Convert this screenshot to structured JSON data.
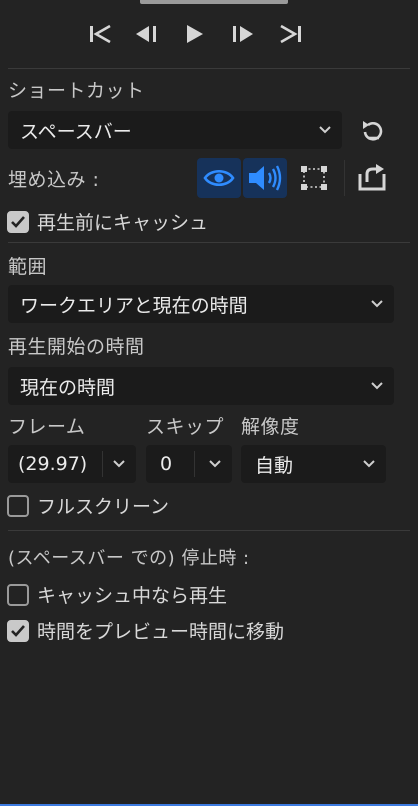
{
  "transport": {
    "buttons": [
      "go-to-in-point",
      "step-back",
      "play",
      "step-forward",
      "go-to-out-point"
    ]
  },
  "shortcut": {
    "label": "ショートカット",
    "value": "スペースバー"
  },
  "embed": {
    "label": "埋め込み :"
  },
  "cache_before_play": {
    "label": "再生前にキャッシュ",
    "checked": true
  },
  "range": {
    "label": "範囲",
    "value": "ワークエリアと現在の時間"
  },
  "start_time": {
    "label": "再生開始の時間",
    "value": "現在の時間"
  },
  "frame": {
    "label": "フレーム",
    "value": "(29.97)"
  },
  "skip": {
    "label": "スキップ",
    "value": "0"
  },
  "resolution": {
    "label": "解像度",
    "value": "自動"
  },
  "fullscreen": {
    "label": "フルスクリーン",
    "checked": false
  },
  "on_stop": {
    "label": "(スペースバー での) 停止時 :",
    "play_if_caching": {
      "label": "キャッシュ中なら再生",
      "checked": false
    },
    "move_time": {
      "label": "時間をプレビュー時間に移動",
      "checked": true
    }
  },
  "colors": {
    "background": "#232323",
    "field": "#1b1b1b",
    "accent": "#2f8cff",
    "active_bg": "#16325a",
    "text": "#d6d6d6"
  }
}
